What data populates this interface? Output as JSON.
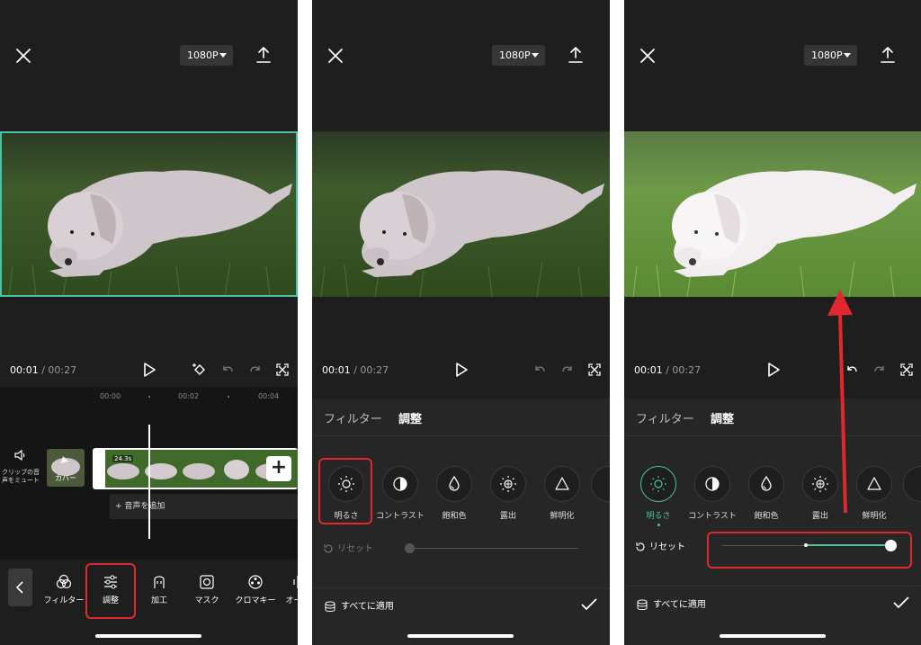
{
  "colors": {
    "accent": "#49c1a3",
    "highlight": "#e0282e",
    "background": "#1e1e1e"
  },
  "header": {
    "resolution": "1080P",
    "close_icon": "close-icon",
    "export_icon": "export-icon"
  },
  "player": {
    "current_time": "00:01",
    "total_time": "/ 00:27"
  },
  "timeline": {
    "ruler": [
      "00:00",
      "00:02",
      "00:04"
    ],
    "mute_label": "クリップの音\n声をミュート",
    "cover_label": "カバー",
    "clip_duration": "24.3s",
    "add_audio": "音声を追加"
  },
  "toolbar": {
    "items": [
      {
        "label": "フィルター",
        "icon": "filter-icon"
      },
      {
        "label": "調整",
        "icon": "adjust-icon"
      },
      {
        "label": "加工",
        "icon": "retouch-icon"
      },
      {
        "label": "マスク",
        "icon": "mask-icon"
      },
      {
        "label": "クロマキー",
        "icon": "chroma-key-icon"
      },
      {
        "label": "オーデ",
        "icon": "audio-icon"
      }
    ]
  },
  "adjust_panel": {
    "tabs": [
      "フィルター",
      "調整"
    ],
    "active_tab": "調整",
    "items": [
      {
        "label": "明るさ",
        "icon": "brightness-icon"
      },
      {
        "label": "コントラスト",
        "icon": "contrast-icon"
      },
      {
        "label": "飽和色",
        "icon": "saturation-icon"
      },
      {
        "label": "露出",
        "icon": "exposure-icon"
      },
      {
        "label": "鮮明化",
        "icon": "sharpen-icon"
      }
    ],
    "reset_label": "リセット",
    "apply_all_label": "すべてに適用",
    "brightness_before": 0.0,
    "brightness_after": 1.0
  }
}
